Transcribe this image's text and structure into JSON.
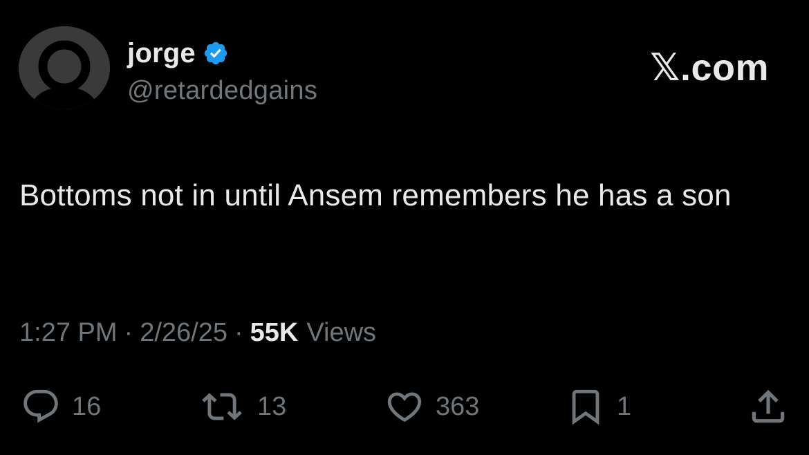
{
  "author": {
    "display_name": "jorge",
    "handle": "@retardedgains",
    "verified": true,
    "verified_color": "#1d9bf0",
    "avatar_icon": "default-profile-icon"
  },
  "brand": "𝕏.com",
  "tweet": {
    "text": "Bottoms not in until Ansem remembers he has a son"
  },
  "meta": {
    "time": "1:27 PM",
    "separator": "·",
    "date": "2/26/25",
    "views_count": "55K",
    "views_label": "Views"
  },
  "actions": {
    "replies": {
      "icon": "reply-icon",
      "count": "16"
    },
    "reposts": {
      "icon": "repost-icon",
      "count": "13"
    },
    "likes": {
      "icon": "like-icon",
      "count": "363"
    },
    "bookmarks": {
      "icon": "bookmark-icon",
      "count": "1"
    },
    "share": {
      "icon": "share-icon"
    }
  },
  "colors": {
    "background": "#000000",
    "primary_text": "#e7e9ea",
    "secondary_text": "#71767b",
    "verified_blue": "#1d9bf0"
  }
}
